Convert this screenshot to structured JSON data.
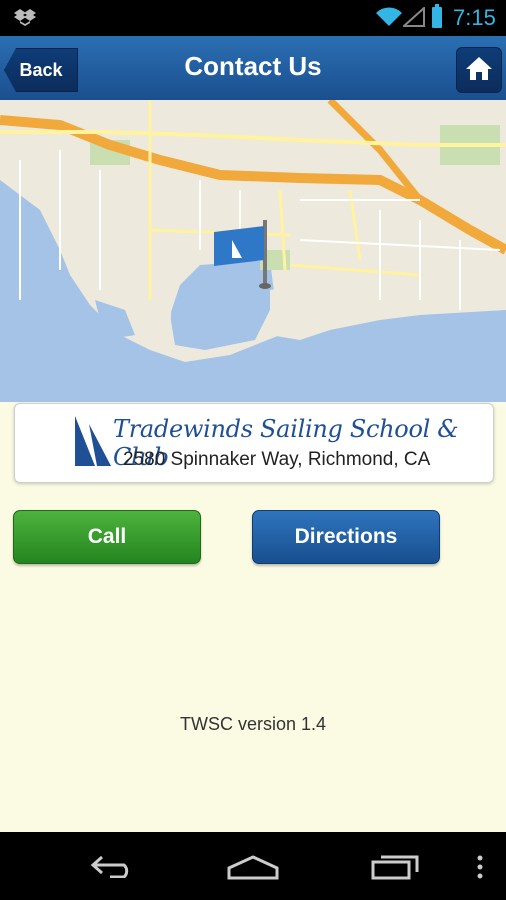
{
  "status_bar": {
    "time": "7:15"
  },
  "header": {
    "back_label": "Back",
    "title": "Contact Us"
  },
  "contact": {
    "name": "Tradewinds Sailing School & Club",
    "address": "2580 Spinnaker Way, Richmond, CA"
  },
  "actions": {
    "call_label": "Call",
    "directions_label": "Directions"
  },
  "footer": {
    "version": "TWSC version 1.4"
  }
}
